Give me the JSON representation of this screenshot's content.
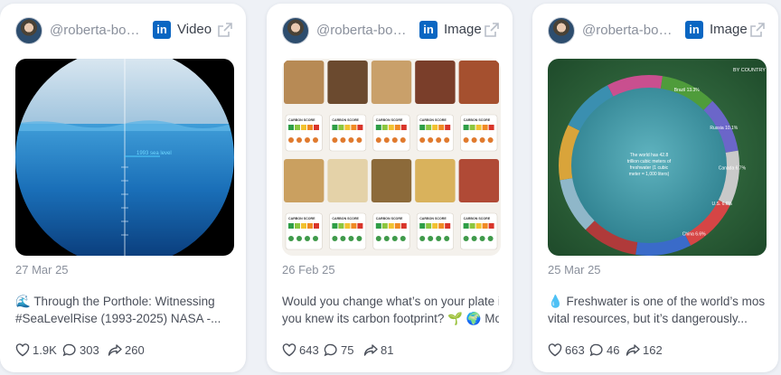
{
  "cards": [
    {
      "handle": "@roberta-bos...",
      "media_type": "Video",
      "date": "27 Mar 25",
      "caption_line1": "🌊 Through the Porthole: Witnessing",
      "caption_line2": "#SeaLevelRise (1993-2025) NASA -...",
      "likes": "1.9K",
      "comments": "303",
      "shares": "260",
      "media": {
        "sea_level_label": "1993 sea level"
      }
    },
    {
      "handle": "@roberta-bos...",
      "media_type": "Image",
      "date": "26 Feb 25",
      "caption_line1": "Would you change what’s on your plate if",
      "caption_line2": "you knew its carbon footprint? 🌱 🌍 Mo...",
      "likes": "643",
      "comments": "75",
      "shares": "81",
      "media": {
        "carbon_score_label": "CARBON SCORE"
      }
    },
    {
      "handle": "@roberta-bos...",
      "media_type": "Image",
      "date": "25 Mar 25",
      "caption_line1": "💧 Freshwater is one of the world’s most",
      "caption_line2": "vital resources, but it’s dangerously...",
      "likes": "663",
      "comments": "46",
      "shares": "162",
      "media": {
        "subtitle": "BY COUNTRY",
        "center_text": "The world has 42.8 trillion cubic meters of freshwater (1 cubic meter = 1,000 liters)",
        "slices": [
          {
            "label": "Brazil",
            "value": "13.3%"
          },
          {
            "label": "Russia",
            "value": "10.1%"
          },
          {
            "label": "Canada",
            "value": "6.7%"
          },
          {
            "label": "U.S.",
            "value": "6.6%"
          },
          {
            "label": "China",
            "value": "6.6%"
          }
        ]
      }
    }
  ],
  "colors": {
    "linkedin": "#0a66c2"
  }
}
